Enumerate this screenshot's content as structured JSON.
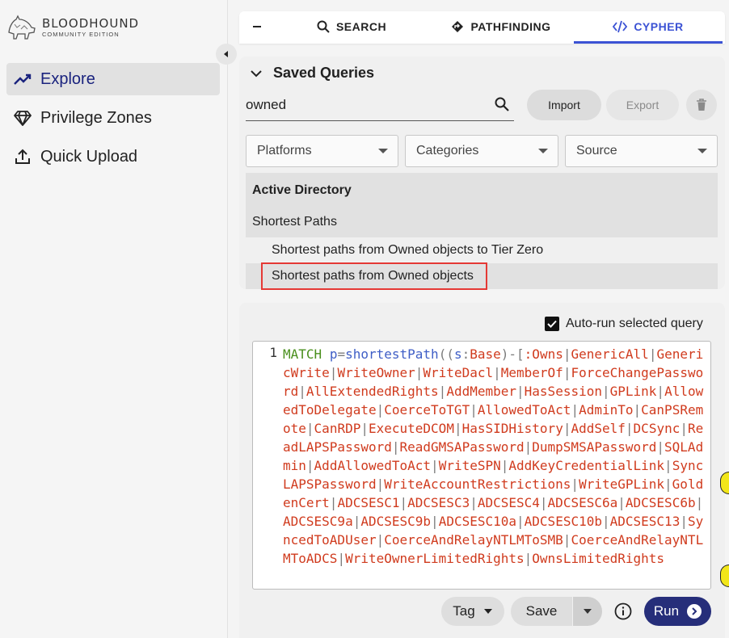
{
  "sidebar": {
    "logo_title": "BLOODHOUND",
    "logo_subtitle": "COMMUNITY EDITION",
    "items": [
      {
        "label": "Explore",
        "icon": "trending-line-icon",
        "active": true
      },
      {
        "label": "Privilege Zones",
        "icon": "gem-icon",
        "active": false
      },
      {
        "label": "Quick Upload",
        "icon": "upload-icon",
        "active": false
      }
    ]
  },
  "tabs": {
    "search": "SEARCH",
    "pathfinding": "PATHFINDING",
    "cypher": "CYPHER",
    "active": "cypher"
  },
  "saved_queries": {
    "title": "Saved Queries",
    "search_value": "owned",
    "import_label": "Import",
    "export_label": "Export",
    "filters": {
      "platforms": "Platforms",
      "categories": "Categories",
      "source": "Source"
    },
    "group": "Active Directory",
    "category": "Shortest Paths",
    "queries": [
      "Shortest paths from Owned objects to Tier Zero",
      "Shortest paths from Owned objects"
    ],
    "selected_index": 1
  },
  "editor": {
    "autorun_label": "Auto-run selected query",
    "autorun_checked": true,
    "line_number": "1",
    "code_prefix": {
      "kw": "MATCH",
      "var_p": "p",
      "eq": "=",
      "fn": "shortestPath",
      "open": "((",
      "var_s": "s",
      "colon": ":",
      "label": "Base",
      "close": ")-[",
      "rel_start": ":Owns"
    },
    "relationships": [
      "GenericAll",
      "GenericWrite",
      "WriteOwner",
      "WriteDacl",
      "MemberOf",
      "ForceChangePassword",
      "AllExtendedRights",
      "AddMember",
      "HasSession",
      "GPLink",
      "AllowedToDelegate",
      "CoerceToTGT",
      "AllowedToAct",
      "AdminTo",
      "CanPSRemote",
      "CanRDP",
      "ExecuteDCOM",
      "HasSIDHistory",
      "AddSelf",
      "DCSync",
      "ReadLAPSPassword",
      "ReadGMSAPassword",
      "DumpSMSAPassword",
      "SQLAdmin",
      "AddAllowedToAct",
      "WriteSPN",
      "AddKeyCredentialLink",
      "SyncLAPSPassword",
      "WriteAccountRestrictions",
      "WriteGPLink",
      "GoldenCert",
      "ADCSESC1",
      "ADCSESC3",
      "ADCSESC4",
      "ADCSESC6a",
      "ADCSESC6b",
      "ADCSESC9a",
      "ADCSESC9b",
      "ADCSESC10a",
      "ADCSESC10b",
      "ADCSESC13",
      "SyncedToADUser",
      "CoerceAndRelayNTLMToSMB",
      "CoerceAndRelayNTLMToADCS",
      "WriteOwnerLimitedRights",
      "OwnsLimitedRights"
    ],
    "tag_label": "Tag",
    "save_label": "Save",
    "run_label": "Run"
  },
  "colors": {
    "accent": "#3b52d4",
    "run_button": "#262e7a",
    "selected_outline": "#e53935",
    "code_keyword": "#4a8f1d",
    "code_identifier": "#3f5ec6",
    "code_relationship": "#d03b1e"
  }
}
